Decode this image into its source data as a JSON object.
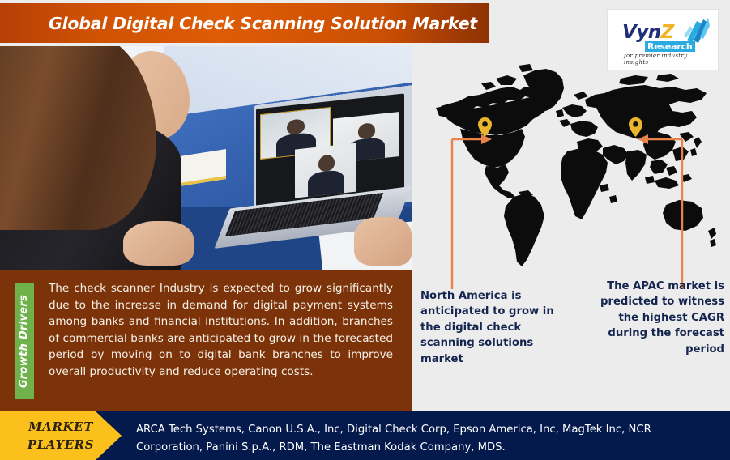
{
  "header": {
    "title": "Global Digital Check Scanning Solution Market"
  },
  "logo": {
    "name_main": "Vyn",
    "name_accent": "Z",
    "subtitle": "Research",
    "tagline": "for premier industry insights",
    "icon": "arrow-burst-icon"
  },
  "photo": {
    "alt": "woman-on-laptop-video-call-photo"
  },
  "growth_drivers": {
    "tab_label": "Growth Drivers",
    "body": "The check scanner Industry is expected to grow significantly due to the increase in demand for digital payment systems among banks and financial institutions. In addition, branches of commercial banks are anticipated to grow in the forecasted period by moving on to digital bank branches to improve overall productivity and reduce operating costs."
  },
  "map": {
    "alt": "world-map-silhouette",
    "markers": [
      {
        "region": "North America",
        "icon": "map-pin-icon"
      },
      {
        "region": "APAC",
        "icon": "map-pin-icon"
      }
    ]
  },
  "callouts": {
    "left": "North America is anticipated to grow in the digital check scanning solutions market",
    "right": "The APAC market is predicted to witness the highest CAGR during the forecast period"
  },
  "market_players": {
    "tag_line1": "MARKET",
    "tag_line2": "PLAYERS",
    "list": "ARCA Tech Systems, Canon U.S.A., Inc, Digital Check Corp, Epson America, Inc, MagTek Inc, NCR Corporation, Panini S.p.A., RDM, The Eastman Kodak Company, MDS."
  },
  "colors": {
    "header_orange": "#cf5103",
    "panel_brown": "#7d3309",
    "tab_green": "#6fb24b",
    "navy": "#04194c",
    "yellow": "#fcc01c",
    "pin_gold": "#e8b52c",
    "connector_orange": "#e8834a",
    "background": "#ececec",
    "callout_navy": "#14264f"
  }
}
